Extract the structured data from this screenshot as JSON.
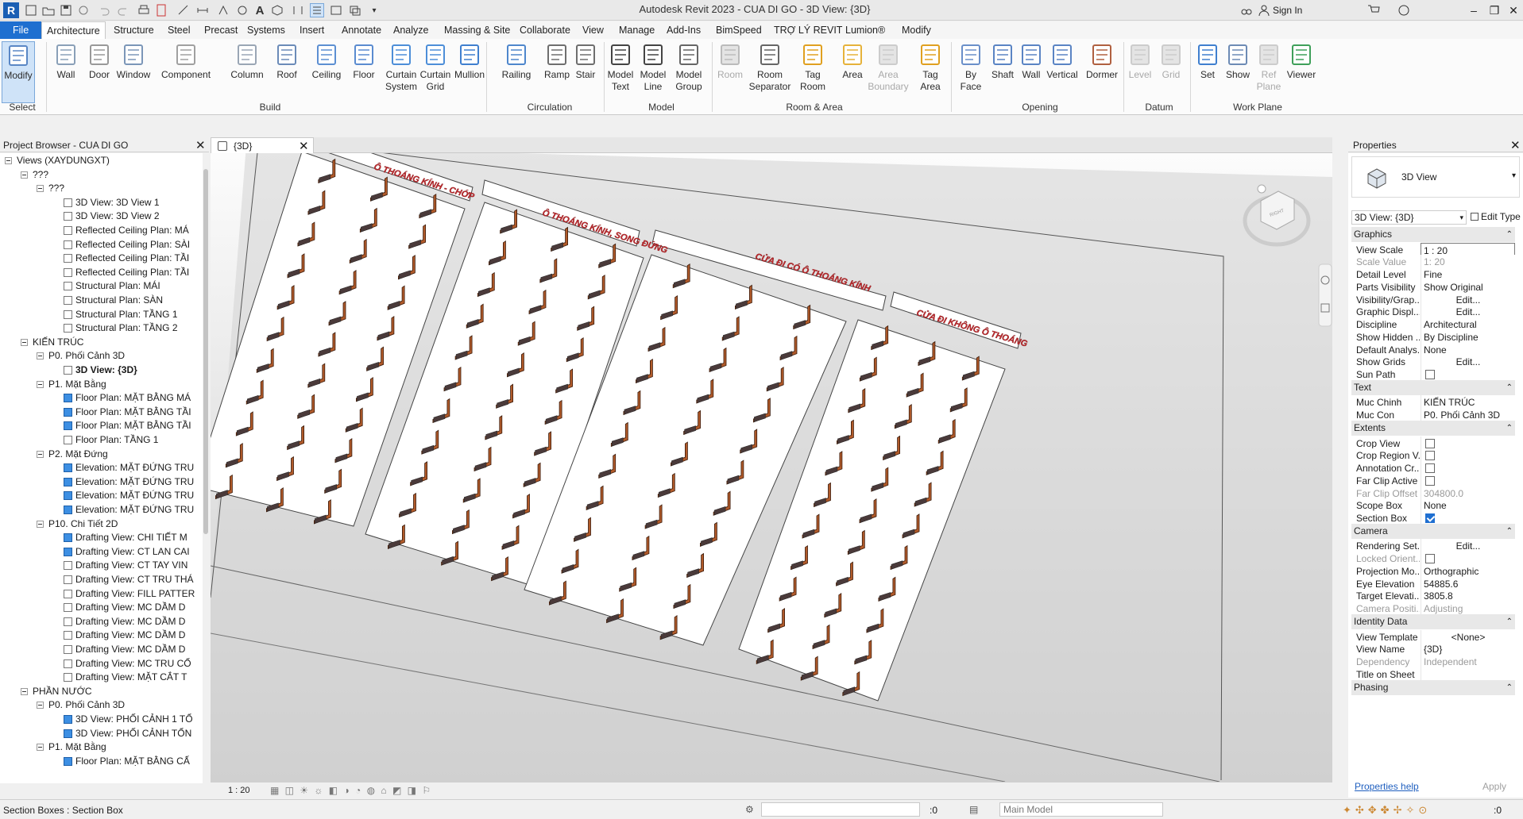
{
  "app": {
    "title": "Autodesk Revit 2023 - CUA DI GO - 3D View: {3D}",
    "logo": "R",
    "sign_in": "Sign In"
  },
  "menu": {
    "tabs": [
      "File",
      "Architecture",
      "Structure",
      "Steel",
      "Precast",
      "Systems",
      "Insert",
      "Annotate",
      "Analyze",
      "Massing & Site",
      "Collaborate",
      "View",
      "Manage",
      "Add-Ins",
      "BimSpeed",
      "TRỢ LÝ REVIT",
      "Lumion®",
      "Modify"
    ]
  },
  "ribbon": {
    "select_label": "Select",
    "buttons": [
      {
        "label": "Modify",
        "icon": "cursor-icon"
      },
      {
        "label": "Wall",
        "icon": "wall-icon"
      },
      {
        "label": "Door",
        "icon": "door-icon"
      },
      {
        "label": "Window",
        "icon": "window-icon"
      },
      {
        "label": "Component",
        "icon": "component-icon"
      },
      {
        "label": "Column",
        "icon": "column-icon"
      },
      {
        "label": "Roof",
        "icon": "roof-icon"
      },
      {
        "label": "Ceiling",
        "icon": "ceiling-icon"
      },
      {
        "label": "Floor",
        "icon": "floor-icon"
      },
      {
        "label": "Curtain System",
        "icon": "curtain-system-icon"
      },
      {
        "label": "Curtain Grid",
        "icon": "curtain-grid-icon"
      },
      {
        "label": "Mullion",
        "icon": "mullion-icon"
      },
      {
        "label": "Railing",
        "icon": "railing-icon"
      },
      {
        "label": "Ramp",
        "icon": "ramp-icon"
      },
      {
        "label": "Stair",
        "icon": "stair-icon"
      },
      {
        "label": "Model Text",
        "icon": "model-text-icon"
      },
      {
        "label": "Model Line",
        "icon": "model-line-icon"
      },
      {
        "label": "Model Group",
        "icon": "model-group-icon"
      },
      {
        "label": "Room",
        "icon": "room-icon",
        "disabled": true
      },
      {
        "label": "Room Separator",
        "icon": "room-separator-icon"
      },
      {
        "label": "Tag Room",
        "icon": "tag-room-icon"
      },
      {
        "label": "Area",
        "icon": "area-icon"
      },
      {
        "label": "Area Boundary",
        "icon": "area-boundary-icon",
        "disabled": true
      },
      {
        "label": "Tag Area",
        "icon": "tag-area-icon"
      },
      {
        "label": "By Face",
        "icon": "by-face-icon"
      },
      {
        "label": "Shaft",
        "icon": "shaft-icon"
      },
      {
        "label": "Wall",
        "icon": "wall-opening-icon"
      },
      {
        "label": "Vertical",
        "icon": "vertical-icon"
      },
      {
        "label": "Dormer",
        "icon": "dormer-icon"
      },
      {
        "label": "Level",
        "icon": "level-icon",
        "disabled": true
      },
      {
        "label": "Grid",
        "icon": "grid-icon",
        "disabled": true
      },
      {
        "label": "Set",
        "icon": "set-icon"
      },
      {
        "label": "Show",
        "icon": "show-icon"
      },
      {
        "label": "Ref Plane",
        "icon": "ref-plane-icon",
        "disabled": true
      },
      {
        "label": "Viewer",
        "icon": "viewer-icon"
      }
    ],
    "panels": [
      "Build",
      "Circulation",
      "Model",
      "Room & Area",
      "Opening",
      "Datum",
      "Work Plane"
    ]
  },
  "project_browser": {
    "title": "Project Browser - CUA DI GO",
    "rows": [
      {
        "text": "Views (XAYDUNGXT)",
        "level": 0,
        "toggle": true,
        "icon": "views-icon"
      },
      {
        "text": "???",
        "level": 1,
        "toggle": true
      },
      {
        "text": "???",
        "level": 2,
        "toggle": true
      },
      {
        "text": "3D View: 3D View 1",
        "level": 3,
        "view": "white"
      },
      {
        "text": "3D View: 3D View 2",
        "level": 3,
        "view": "white"
      },
      {
        "text": "Reflected Ceiling Plan: MÁ",
        "level": 3,
        "view": "white"
      },
      {
        "text": "Reflected Ceiling Plan: SÀI",
        "level": 3,
        "view": "white"
      },
      {
        "text": "Reflected Ceiling Plan: TẦI",
        "level": 3,
        "view": "white"
      },
      {
        "text": "Reflected Ceiling Plan: TẦI",
        "level": 3,
        "view": "white"
      },
      {
        "text": "Structural Plan: MÁI",
        "level": 3,
        "view": "white"
      },
      {
        "text": "Structural Plan: SÀN",
        "level": 3,
        "view": "white"
      },
      {
        "text": "Structural Plan: TẦNG 1",
        "level": 3,
        "view": "white"
      },
      {
        "text": "Structural Plan: TẦNG 2",
        "level": 3,
        "view": "white"
      },
      {
        "text": "KIẾN TRÚC",
        "level": 1,
        "toggle": true
      },
      {
        "text": "P0. Phối Cảnh 3D",
        "level": 2,
        "toggle": true
      },
      {
        "text": "3D View: {3D}",
        "level": 3,
        "view": "white",
        "selected": true
      },
      {
        "text": "P1. Mặt Bằng",
        "level": 2,
        "toggle": true
      },
      {
        "text": "Floor Plan: MẶT BẰNG MÁ",
        "level": 3,
        "view": "blue"
      },
      {
        "text": "Floor Plan: MẶT BẰNG TẦI",
        "level": 3,
        "view": "blue"
      },
      {
        "text": "Floor Plan: MẶT BẰNG TẦI",
        "level": 3,
        "view": "blue"
      },
      {
        "text": "Floor Plan: TẦNG 1",
        "level": 3,
        "view": "white"
      },
      {
        "text": "P2. Mặt Đứng",
        "level": 2,
        "toggle": true
      },
      {
        "text": "Elevation: MẶT ĐỨNG TRU",
        "level": 3,
        "view": "blue"
      },
      {
        "text": "Elevation: MẶT ĐỨNG TRU",
        "level": 3,
        "view": "blue"
      },
      {
        "text": "Elevation: MẶT ĐỨNG TRU",
        "level": 3,
        "view": "blue"
      },
      {
        "text": "Elevation: MẶT ĐỨNG TRU",
        "level": 3,
        "view": "blue"
      },
      {
        "text": "P10. Chi Tiết 2D",
        "level": 2,
        "toggle": true
      },
      {
        "text": "Drafting View: CHI TIẾT M",
        "level": 3,
        "view": "blue"
      },
      {
        "text": "Drafting View: CT LAN CAI",
        "level": 3,
        "view": "blue"
      },
      {
        "text": "Drafting View: CT TAY VIN",
        "level": 3,
        "view": "white"
      },
      {
        "text": "Drafting View: CT TRU THÁ",
        "level": 3,
        "view": "white"
      },
      {
        "text": "Drafting View: FILL PATTER",
        "level": 3,
        "view": "white"
      },
      {
        "text": "Drafting View: MC DẦM D",
        "level": 3,
        "view": "white"
      },
      {
        "text": "Drafting View: MC DẦM D",
        "level": 3,
        "view": "white"
      },
      {
        "text": "Drafting View: MC DẦM D",
        "level": 3,
        "view": "white"
      },
      {
        "text": "Drafting View: MC DẦM D",
        "level": 3,
        "view": "white"
      },
      {
        "text": "Drafting View: MC TRU CỔ",
        "level": 3,
        "view": "white"
      },
      {
        "text": "Drafting View: MẶT CẮT T",
        "level": 3,
        "view": "white"
      },
      {
        "text": "PHẦN NƯỚC",
        "level": 1,
        "toggle": true
      },
      {
        "text": "P0. Phối Cảnh 3D",
        "level": 2,
        "toggle": true
      },
      {
        "text": "3D View: PHỐI CẢNH 1 TỔ",
        "level": 3,
        "view": "blue"
      },
      {
        "text": "3D View: PHỐI CẢNH TỔN",
        "level": 3,
        "view": "blue"
      },
      {
        "text": "P1. Mặt Bằng",
        "level": 2,
        "toggle": true
      },
      {
        "text": "Floor Plan: MẶT BẰNG CẤ",
        "level": 3,
        "view": "blue"
      }
    ]
  },
  "view": {
    "tab_label": "{3D}",
    "scale": "1 : 20",
    "labels": [
      "Ô THOÁNG KÍNH - CHỚP",
      "Ô THOÁNG KÍNH, SONG ĐỨNG",
      "CỬA ĐI CÓ Ô THOÁNG KÍNH",
      "CỬA ĐI KHÔNG Ô THOÁNG"
    ],
    "viewcube_label": "RIGHT",
    "accent": "#b05a2a",
    "label_color": "#c0282d"
  },
  "properties": {
    "title": "Properties",
    "type_name": "3D View",
    "instance_selector": "3D View: {3D}",
    "edit_type": "Edit Type",
    "rows": [
      {
        "group": "Graphics"
      },
      {
        "name": "View Scale",
        "value": "1 : 20",
        "style": "box"
      },
      {
        "name": "Scale Value",
        "value": "1:  20",
        "dim": true
      },
      {
        "name": "Detail Level",
        "value": "Fine"
      },
      {
        "name": "Parts Visibility",
        "value": "Show Original"
      },
      {
        "name": "Visibility/Grap...",
        "value": "Edit...",
        "style": "btn"
      },
      {
        "name": "Graphic Displ...",
        "value": "Edit...",
        "style": "btn"
      },
      {
        "name": "Discipline",
        "value": "Architectural"
      },
      {
        "name": "Show Hidden ...",
        "value": "By Discipline"
      },
      {
        "name": "Default Analys...",
        "value": "None"
      },
      {
        "name": "Show Grids",
        "value": "Edit...",
        "style": "btn"
      },
      {
        "name": "Sun Path",
        "check": false
      },
      {
        "group": "Text"
      },
      {
        "name": "Muc Chinh",
        "value": "KIẾN TRÚC"
      },
      {
        "name": "Muc Con",
        "value": "P0. Phối Cảnh 3D"
      },
      {
        "group": "Extents"
      },
      {
        "name": "Crop View",
        "check": false
      },
      {
        "name": "Crop Region V...",
        "check": false
      },
      {
        "name": "Annotation Cr...",
        "check": false
      },
      {
        "name": "Far Clip Active",
        "check": false
      },
      {
        "name": "Far Clip Offset",
        "value": "304800.0",
        "dim": true
      },
      {
        "name": "Scope Box",
        "value": "None"
      },
      {
        "name": "Section Box",
        "check": true
      },
      {
        "group": "Camera"
      },
      {
        "name": "Rendering Set...",
        "value": "Edit...",
        "style": "btn"
      },
      {
        "name": "Locked Orient...",
        "check": false,
        "dim": true
      },
      {
        "name": "Projection Mo...",
        "value": "Orthographic"
      },
      {
        "name": "Eye Elevation",
        "value": "54885.6"
      },
      {
        "name": "Target Elevati...",
        "value": "3805.8"
      },
      {
        "name": "Camera Positi...",
        "value": "Adjusting",
        "dim": true
      },
      {
        "group": "Identity Data"
      },
      {
        "name": "View Template",
        "value": "<None>",
        "style": "btn"
      },
      {
        "name": "View Name",
        "value": "{3D}"
      },
      {
        "name": "Dependency",
        "value": "Independent",
        "dim": true
      },
      {
        "name": "Title on Sheet",
        "value": ""
      },
      {
        "group": "Phasing"
      }
    ],
    "help_link": "Properties help",
    "apply": "Apply"
  },
  "status": {
    "text": "Section Boxes : Section Box",
    "model": "Main Model",
    "zero": ":0"
  }
}
